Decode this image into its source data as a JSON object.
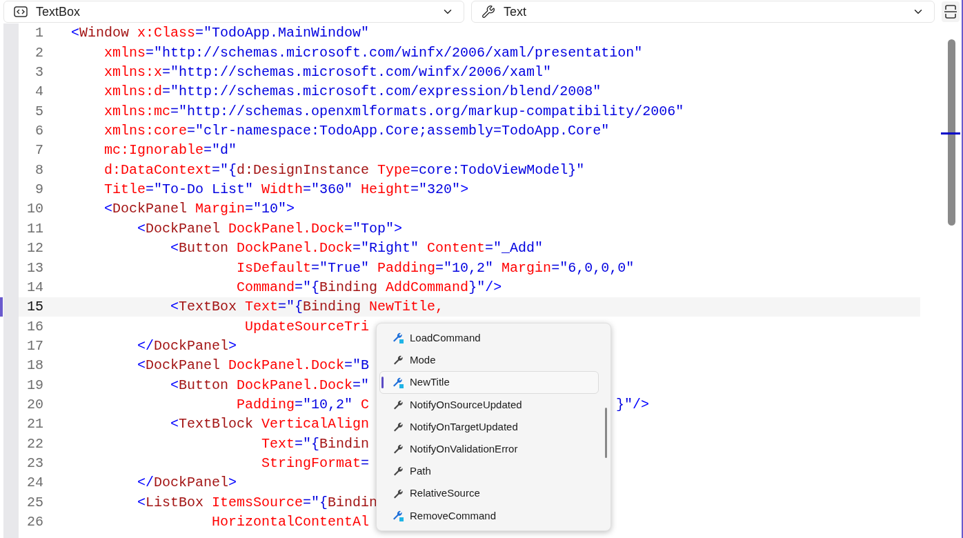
{
  "element_selector": {
    "label": "TextBox"
  },
  "member_selector": {
    "label": "Text"
  },
  "lines": [
    {
      "n": "1",
      "current": false,
      "tokens": [
        {
          "kind": "p",
          "text": "<"
        },
        {
          "kind": "tag",
          "text": "Window"
        },
        {
          "kind": "attr",
          "text": " x:Class"
        },
        {
          "kind": "val",
          "text": "=\"TodoApp.MainWindow\""
        }
      ]
    },
    {
      "n": "2",
      "current": false,
      "tokens": [
        {
          "kind": "attr",
          "text": "    xmlns"
        },
        {
          "kind": "val",
          "text": "=\"http://schemas.microsoft.com/winfx/2006/xaml/presentation\""
        }
      ]
    },
    {
      "n": "3",
      "current": false,
      "tokens": [
        {
          "kind": "attr",
          "text": "    xmlns:x"
        },
        {
          "kind": "val",
          "text": "=\"http://schemas.microsoft.com/winfx/2006/xaml\""
        }
      ]
    },
    {
      "n": "4",
      "current": false,
      "tokens": [
        {
          "kind": "attr",
          "text": "    xmlns:d"
        },
        {
          "kind": "val",
          "text": "=\"http://schemas.microsoft.com/expression/blend/2008\""
        }
      ]
    },
    {
      "n": "5",
      "current": false,
      "tokens": [
        {
          "kind": "attr",
          "text": "    xmlns:mc"
        },
        {
          "kind": "val",
          "text": "=\"http://schemas.openxmlformats.org/markup-compatibility/2006\""
        }
      ]
    },
    {
      "n": "6",
      "current": false,
      "tokens": [
        {
          "kind": "attr",
          "text": "    xmlns:core"
        },
        {
          "kind": "val",
          "text": "=\"clr-namespace:TodoApp.Core;assembly=TodoApp.Core\""
        }
      ]
    },
    {
      "n": "7",
      "current": false,
      "tokens": [
        {
          "kind": "attr",
          "text": "    mc:Ignorable"
        },
        {
          "kind": "val",
          "text": "=\"d\""
        }
      ]
    },
    {
      "n": "8",
      "current": false,
      "tokens": [
        {
          "kind": "attr",
          "text": "    d:DataContext"
        },
        {
          "kind": "val",
          "text": "=\"{"
        },
        {
          "kind": "tag",
          "text": "d:DesignInstance"
        },
        {
          "kind": "attr",
          "text": " Type"
        },
        {
          "kind": "val",
          "text": "=core:TodoViewModel}\""
        }
      ]
    },
    {
      "n": "9",
      "current": false,
      "tokens": [
        {
          "kind": "attr",
          "text": "    Title"
        },
        {
          "kind": "val",
          "text": "=\"To-Do List\""
        },
        {
          "kind": "attr",
          "text": " Width"
        },
        {
          "kind": "val",
          "text": "=\"360\""
        },
        {
          "kind": "attr",
          "text": " Height"
        },
        {
          "kind": "val",
          "text": "=\"320\""
        },
        {
          "kind": "p",
          "text": ">"
        }
      ]
    },
    {
      "n": "10",
      "current": false,
      "tokens": [
        {
          "kind": "p",
          "text": "    <"
        },
        {
          "kind": "tag",
          "text": "DockPanel"
        },
        {
          "kind": "attr",
          "text": " Margin"
        },
        {
          "kind": "val",
          "text": "=\"10\""
        },
        {
          "kind": "p",
          "text": ">"
        }
      ]
    },
    {
      "n": "11",
      "current": false,
      "tokens": [
        {
          "kind": "p",
          "text": "        <"
        },
        {
          "kind": "tag",
          "text": "DockPanel"
        },
        {
          "kind": "attr",
          "text": " DockPanel.Dock"
        },
        {
          "kind": "val",
          "text": "=\"Top\""
        },
        {
          "kind": "p",
          "text": ">"
        }
      ]
    },
    {
      "n": "12",
      "current": false,
      "tokens": [
        {
          "kind": "p",
          "text": "            <"
        },
        {
          "kind": "tag",
          "text": "Button"
        },
        {
          "kind": "attr",
          "text": " DockPanel.Dock"
        },
        {
          "kind": "val",
          "text": "=\"Right\""
        },
        {
          "kind": "attr",
          "text": " Content"
        },
        {
          "kind": "val",
          "text": "=\"_Add\""
        }
      ]
    },
    {
      "n": "13",
      "current": false,
      "tokens": [
        {
          "kind": "attr",
          "text": "                    IsDefault"
        },
        {
          "kind": "val",
          "text": "=\"True\""
        },
        {
          "kind": "attr",
          "text": " Padding"
        },
        {
          "kind": "val",
          "text": "=\"10,2\""
        },
        {
          "kind": "attr",
          "text": " Margin"
        },
        {
          "kind": "val",
          "text": "=\"6,0,0,0\""
        }
      ]
    },
    {
      "n": "14",
      "current": false,
      "tokens": [
        {
          "kind": "attr",
          "text": "                    Command"
        },
        {
          "kind": "val",
          "text": "=\"{"
        },
        {
          "kind": "tag",
          "text": "Binding"
        },
        {
          "kind": "attr",
          "text": " AddCommand"
        },
        {
          "kind": "val",
          "text": "}\""
        },
        {
          "kind": "p",
          "text": "/>"
        }
      ]
    },
    {
      "n": "15",
      "current": true,
      "tokens": [
        {
          "kind": "p",
          "text": "            <"
        },
        {
          "kind": "tag",
          "text": "TextBox"
        },
        {
          "kind": "attr",
          "text": " Text"
        },
        {
          "kind": "val",
          "text": "=\"{"
        },
        {
          "kind": "tag",
          "text": "Binding"
        },
        {
          "kind": "attr",
          "text": " NewTitle,"
        }
      ]
    },
    {
      "n": "16",
      "current": false,
      "tokens": [
        {
          "kind": "attr",
          "text": "                     UpdateSourceTri"
        }
      ]
    },
    {
      "n": "17",
      "current": false,
      "tokens": [
        {
          "kind": "p",
          "text": "        </"
        },
        {
          "kind": "tag",
          "text": "DockPanel"
        },
        {
          "kind": "p",
          "text": ">"
        }
      ]
    },
    {
      "n": "18",
      "current": false,
      "tokens": [
        {
          "kind": "p",
          "text": "        <"
        },
        {
          "kind": "tag",
          "text": "DockPanel"
        },
        {
          "kind": "attr",
          "text": " DockPanel.Dock"
        },
        {
          "kind": "val",
          "text": "=\"B"
        }
      ]
    },
    {
      "n": "19",
      "current": false,
      "tokens": [
        {
          "kind": "p",
          "text": "            <"
        },
        {
          "kind": "tag",
          "text": "Button"
        },
        {
          "kind": "attr",
          "text": " DockPanel.Dock"
        },
        {
          "kind": "val",
          "text": "=\""
        }
      ]
    },
    {
      "n": "20",
      "current": false,
      "tokens": [
        {
          "kind": "attr",
          "text": "                    Padding"
        },
        {
          "kind": "val",
          "text": "=\"10,2\""
        },
        {
          "kind": "attr",
          "text": " C"
        }
      ],
      "after": [
        {
          "kind": "val",
          "text": "}\""
        },
        {
          "kind": "p",
          "text": "/>"
        }
      ]
    },
    {
      "n": "21",
      "current": false,
      "tokens": [
        {
          "kind": "p",
          "text": "            <"
        },
        {
          "kind": "tag",
          "text": "TextBlock"
        },
        {
          "kind": "attr",
          "text": " VerticalAlign"
        }
      ]
    },
    {
      "n": "22",
      "current": false,
      "tokens": [
        {
          "kind": "attr",
          "text": "                       Text"
        },
        {
          "kind": "val",
          "text": "=\"{"
        },
        {
          "kind": "tag",
          "text": "Bindin"
        }
      ]
    },
    {
      "n": "23",
      "current": false,
      "tokens": [
        {
          "kind": "attr",
          "text": "                       StringFormat"
        },
        {
          "kind": "val",
          "text": "="
        }
      ]
    },
    {
      "n": "24",
      "current": false,
      "tokens": [
        {
          "kind": "p",
          "text": "        </"
        },
        {
          "kind": "tag",
          "text": "DockPanel"
        },
        {
          "kind": "p",
          "text": ">"
        }
      ]
    },
    {
      "n": "25",
      "current": false,
      "tokens": [
        {
          "kind": "p",
          "text": "        <"
        },
        {
          "kind": "tag",
          "text": "ListBox"
        },
        {
          "kind": "attr",
          "text": " ItemsSource"
        },
        {
          "kind": "val",
          "text": "=\"{"
        },
        {
          "kind": "tag",
          "text": "Bindin"
        }
      ]
    },
    {
      "n": "26",
      "current": false,
      "tokens": [
        {
          "kind": "attr",
          "text": "                 HorizontalContentAl"
        }
      ]
    }
  ],
  "completion": [
    {
      "label": "LoadCommand",
      "kind": "command",
      "selected": false
    },
    {
      "label": "Mode",
      "kind": "property",
      "selected": false
    },
    {
      "label": "NewTitle",
      "kind": "command",
      "selected": true
    },
    {
      "label": "NotifyOnSourceUpdated",
      "kind": "property",
      "selected": false
    },
    {
      "label": "NotifyOnTargetUpdated",
      "kind": "property",
      "selected": false
    },
    {
      "label": "NotifyOnValidationError",
      "kind": "property",
      "selected": false
    },
    {
      "label": "Path",
      "kind": "property",
      "selected": false
    },
    {
      "label": "RelativeSource",
      "kind": "property",
      "selected": false
    },
    {
      "label": "RemoveCommand",
      "kind": "command",
      "selected": false
    }
  ]
}
